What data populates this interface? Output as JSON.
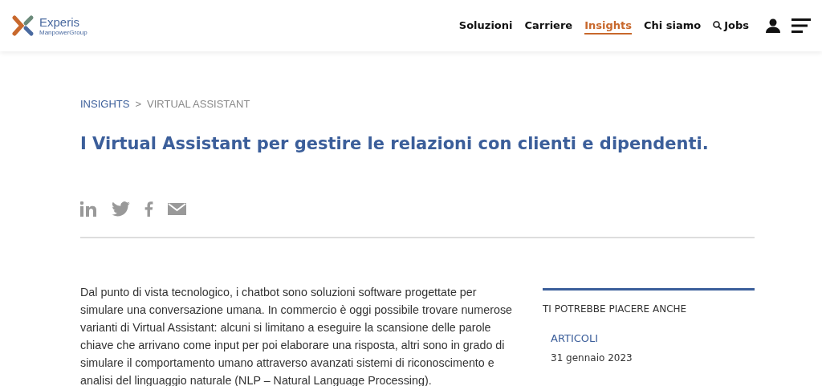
{
  "header": {
    "logo": {
      "name": "Experis",
      "sub": "ManpowerGroup"
    },
    "nav": [
      {
        "label": "Soluzioni",
        "selected": false
      },
      {
        "label": "Carriere",
        "selected": false
      },
      {
        "label": "Insights",
        "selected": true
      },
      {
        "label": "Chi siamo",
        "selected": false
      },
      {
        "label": "Jobs",
        "selected": false,
        "kind": "search"
      }
    ]
  },
  "breadcrumb": [
    {
      "label": "INSIGHTS",
      "kind": "link"
    },
    {
      "label": ">",
      "kind": "separator"
    },
    {
      "label": "VIRTUAL ASSISTANT",
      "kind": "current"
    }
  ],
  "title": "I Virtual Assistant per gestire le relazioni con clienti e dipendenti.",
  "share": [
    {
      "kind": "linkedin"
    },
    {
      "kind": "twitter"
    },
    {
      "kind": "facebook"
    },
    {
      "kind": "email"
    }
  ],
  "body": "Dal punto di vista tecnologico, i chatbot sono soluzioni software progettate per simulare una conversazione umana. In commercio è oggi possibile trovare numerose varianti di Virtual Assistant: alcuni si limitano a eseguire la scansione delle parole chiave che arrivano come input per poi elaborare una risposta, altri sono in grado di simulare il comportamento umano attraverso avanzati sistemi di riconoscimento e analisi del linguaggio naturale (NLP – Natural Language Processing).",
  "sidebar": {
    "heading": "TI POTREBBE PIACERE ANCHE",
    "category": "ARTICOLI",
    "date": "31 gennaio 2023"
  }
}
